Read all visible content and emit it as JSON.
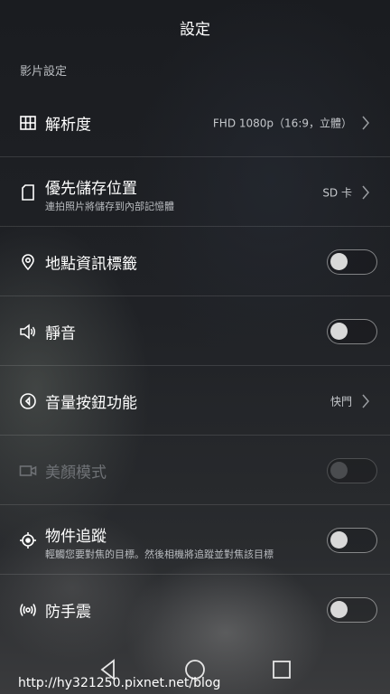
{
  "header": {
    "title": "設定"
  },
  "section": {
    "title": "影片設定"
  },
  "rows": [
    {
      "label": "解析度",
      "value": "FHD 1080p（16:9，立體）"
    },
    {
      "label": "優先儲存位置",
      "sub": "連拍照片將儲存到內部記憶體",
      "value": "SD 卡"
    },
    {
      "label": "地點資訊標籤",
      "toggle": false
    },
    {
      "label": "靜音",
      "toggle": false
    },
    {
      "label": "音量按鈕功能",
      "value": "快門"
    },
    {
      "label": "美顏模式",
      "toggle": false,
      "disabled": true
    },
    {
      "label": "物件追蹤",
      "sub": "輕觸您要對焦的目標。然後相機將追蹤並對焦該目標",
      "toggle": false
    },
    {
      "label": "防手震",
      "toggle": false
    }
  ],
  "watermark": "http://hy321250.pixnet.net/blog"
}
